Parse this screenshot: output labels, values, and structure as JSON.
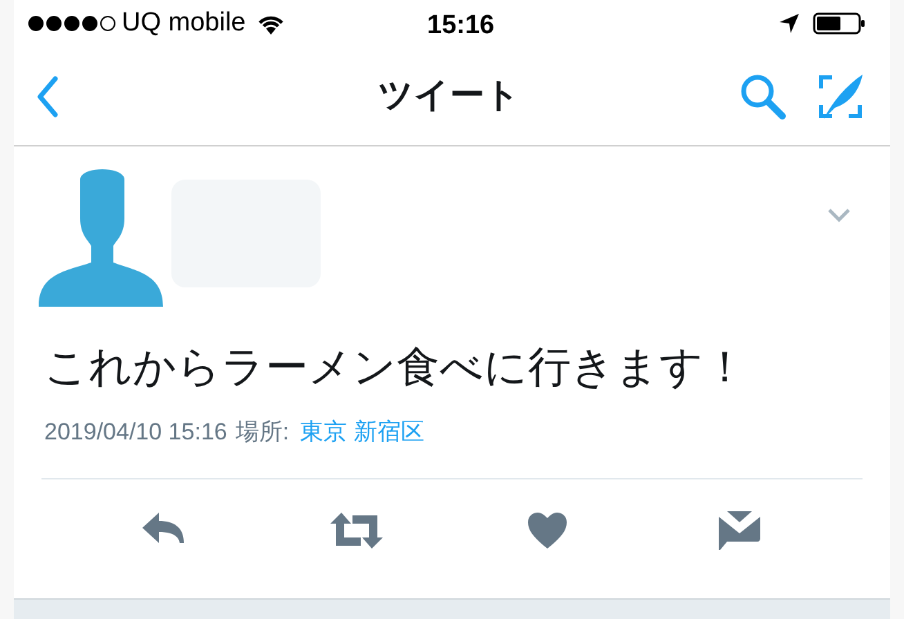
{
  "status_bar": {
    "carrier": "UQ mobile",
    "time": "15:16"
  },
  "nav": {
    "title": "ツイート"
  },
  "tweet": {
    "text": "これからラーメン食べに行きます！",
    "timestamp": "2019/04/10 15:16",
    "place_label": "場所:",
    "place": "東京 新宿区"
  }
}
